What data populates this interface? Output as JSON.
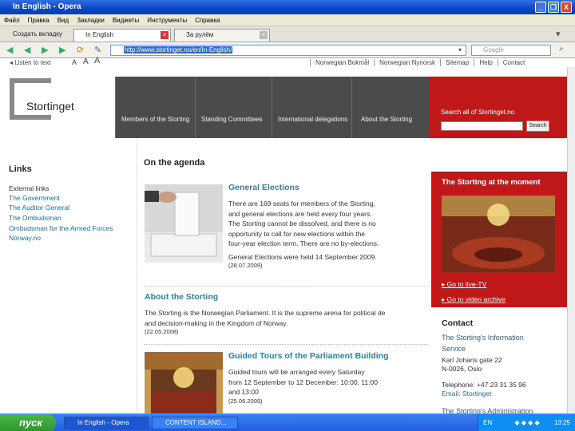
{
  "window": {
    "title": "In English - Opera",
    "btn_minimize": "_",
    "btn_restore": "❐",
    "btn_close": "X"
  },
  "menu": [
    "Файл",
    "Правка",
    "Вид",
    "Закладки",
    "Виджеты",
    "Инструменты",
    "Справка"
  ],
  "tabs": [
    {
      "label": "Создать вкладку"
    },
    {
      "label": "In English"
    },
    {
      "label": "За рулём"
    }
  ],
  "addressbar": {
    "url": "http://www.stortinget.no/en/In-English/",
    "search_placeholder": "Google"
  },
  "topstrip": {
    "listen": "Listen to text",
    "font_sizes": [
      "A",
      "A",
      "A"
    ],
    "links": [
      "Norwegian Bokmål",
      "Norwegian Nynorsk",
      "Sitemap",
      "Help",
      "Contact"
    ]
  },
  "header": {
    "logo_text": "Stortinget",
    "nav": [
      "Members of the Storting",
      "Standing Committees",
      "International delegations",
      "About the Storting"
    ],
    "search_label": "Search all of Stortinget.no",
    "search_button": "Search"
  },
  "sidebar": {
    "heading": "Links",
    "links": [
      "External links",
      "The Government",
      "The Auditor General",
      "The Ombudsman",
      "Ombudsman for the Armed Forces",
      "Norway.no"
    ]
  },
  "agenda": {
    "heading": "On the agenda",
    "items": [
      {
        "title": "General Elections",
        "body": [
          "There are 169 seats for members of the Storting,",
          "and general elections are held every four years.",
          "The Storting cannot be dissolved, and there is no",
          "opportunity to call for new elections within the",
          "four-year election term. There are no by-elections."
        ],
        "note": "General Elections were held 14 September 2009.",
        "date": "(28.07.2009)"
      },
      {
        "title": "About the Storting",
        "body": [
          "The Storting is the Norwegian Parliament. It is the supreme arena for political de",
          "and decision-making in the Kingdom of Norway."
        ],
        "date": "(22.05.2008)"
      },
      {
        "title": "Guided Tours of the Parliament Building",
        "body": [
          "Guided tours will be arranged every Saturday",
          "from 12 September to 12 December: 10:00, 11:00",
          "and 13:00"
        ],
        "date": "(25.06.2009)"
      }
    ]
  },
  "rightcol": {
    "title": "The Storting at the moment",
    "links": [
      "Go to live-TV",
      "Go to video archive"
    ],
    "contact_heading": "Contact",
    "contact_lines": [
      "The Storting's Information",
      "Service",
      "Karl Johans gate 22",
      "N-0026, Oslo",
      "",
      "Telephone: +47 23 31 35 96",
      "Email: Stortinget",
      "",
      "The Storting's Administration"
    ]
  },
  "taskbar": {
    "start": "пуск",
    "tasks": [
      "In English - Opera",
      "CONTENT ISLAND..."
    ],
    "lang": "EN",
    "clock": "13:25"
  }
}
